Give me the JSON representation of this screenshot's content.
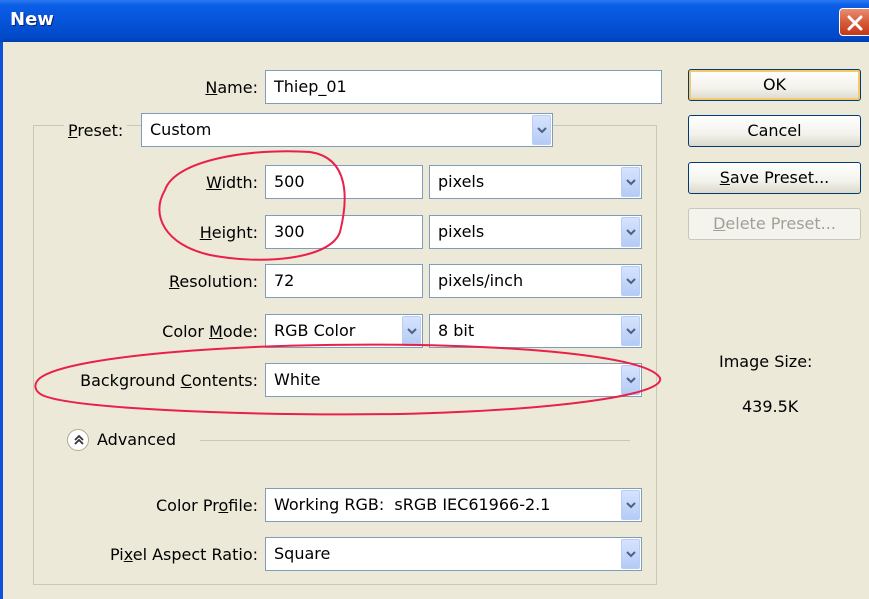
{
  "window": {
    "title": "New"
  },
  "name": {
    "label": "Name:",
    "value": "Thiep_01"
  },
  "preset": {
    "label": "Preset:",
    "value": "Custom"
  },
  "width": {
    "label": "Width:",
    "value": "500",
    "unit": "pixels"
  },
  "height": {
    "label": "Height:",
    "value": "300",
    "unit": "pixels"
  },
  "resolution": {
    "label": "Resolution:",
    "value": "72",
    "unit": "pixels/inch"
  },
  "color_mode": {
    "label": "Color Mode:",
    "value": "RGB Color",
    "depth": "8 bit"
  },
  "background": {
    "label": "Background Contents:",
    "value": "White"
  },
  "advanced": {
    "label": "Advanced"
  },
  "color_profile": {
    "label": "Color Profile:",
    "value": "Working RGB:  sRGB IEC61966-2.1"
  },
  "pixel_aspect": {
    "label": "Pixel Aspect Ratio:",
    "value": "Square"
  },
  "buttons": {
    "ok": "OK",
    "cancel": "Cancel",
    "save_preset": "Save Preset...",
    "delete_preset": "Delete Preset..."
  },
  "image_size": {
    "label": "Image Size:",
    "value": "439.5K"
  },
  "colors": {
    "titlebar": "#0654d9",
    "annotation": "#e8204a",
    "dialog_bg": "#ece9d8"
  }
}
